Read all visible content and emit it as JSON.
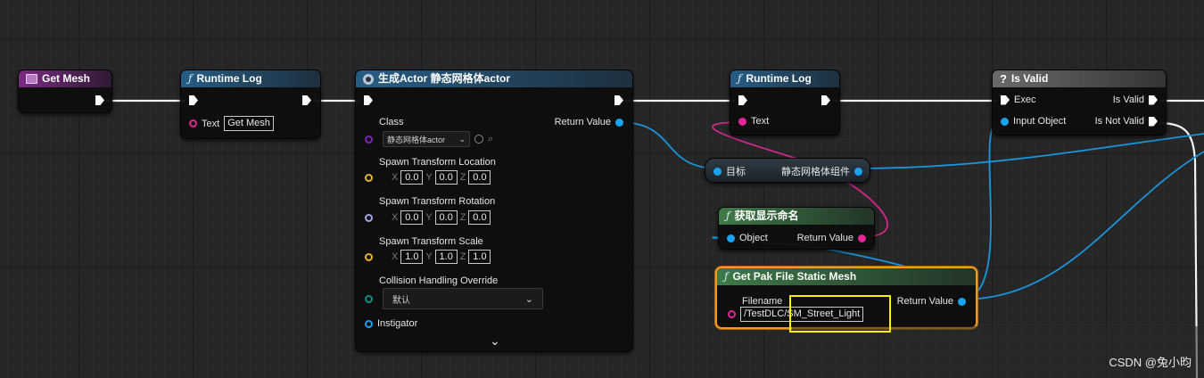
{
  "nodes": {
    "get_mesh": {
      "title": "Get Mesh"
    },
    "runtime_log_1": {
      "title": "Runtime Log",
      "text_label": "Text",
      "text_value": "Get Mesh"
    },
    "spawn_actor": {
      "title": "生成Actor 静态网格体actor",
      "class_label": "Class",
      "class_value": "静态网格体actor",
      "return_label": "Return Value",
      "location_label": "Spawn Transform Location",
      "location": {
        "x": "0.0",
        "y": "0.0",
        "z": "0.0"
      },
      "rotation_label": "Spawn Transform Rotation",
      "rotation": {
        "x": "0.0",
        "y": "0.0",
        "z": "0.0"
      },
      "scale_label": "Spawn Transform Scale",
      "scale": {
        "x": "1.0",
        "y": "1.0",
        "z": "1.0"
      },
      "collision_label": "Collision Handling Override",
      "collision_value": "默认",
      "instigator_label": "Instigator",
      "axis_x": "X",
      "axis_y": "Y",
      "axis_z": "Z"
    },
    "runtime_log_2": {
      "title": "Runtime Log",
      "text_label": "Text"
    },
    "target_getter": {
      "target_label": "目标",
      "component_label": "静态网格体组件"
    },
    "get_display_name": {
      "title": "获取显示命名",
      "object_label": "Object",
      "return_label": "Return Value"
    },
    "get_pak_file": {
      "title": "Get Pak File Static Mesh",
      "filename_label": "Filename",
      "filename_value": "/TestDLC/SM_Street_Light",
      "return_label": "Return Value"
    },
    "is_valid": {
      "title": "Is Valid",
      "exec_label": "Exec",
      "input_label": "Input Object",
      "is_valid_label": "Is Valid",
      "is_not_valid_label": "Is Not Valid"
    }
  },
  "watermark": "CSDN @兔小昀",
  "colors": {
    "exec": "#ffffff",
    "object_pin": "#1aa3f0",
    "text_pin": "#e02795",
    "class_pin": "#7b22b7",
    "vector_pin": "#e3b52a",
    "rotator_pin": "#a3a6e3",
    "enum_pin": "#0f8d83",
    "selected_outline": "#f39a1c",
    "callout": "#fff200"
  },
  "icons": [
    "mesh-icon",
    "function-icon",
    "spawn-icon",
    "question-icon",
    "chevron-down-icon",
    "reset-icon",
    "browse-icon"
  ]
}
